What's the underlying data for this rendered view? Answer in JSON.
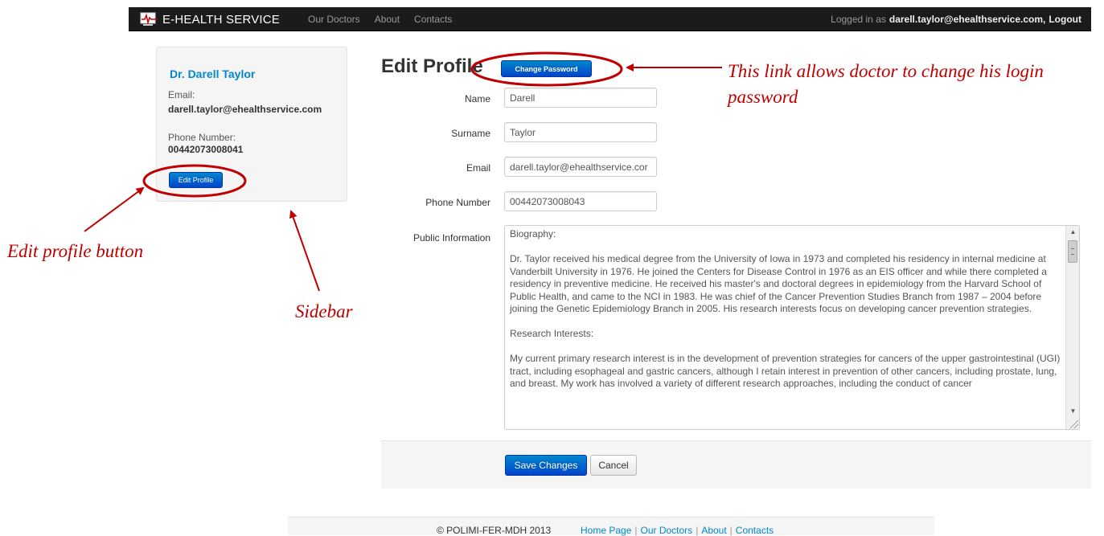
{
  "navbar": {
    "brand": "E-HEALTH SERVICE",
    "links": [
      "Our Doctors",
      "About",
      "Contacts"
    ],
    "logged_in_prefix": "Logged in as",
    "user_email": "darell.taylor@ehealthservice.com,",
    "logout": "Logout"
  },
  "sidebar": {
    "name": "Dr. Darell Taylor",
    "email_label": "Email:",
    "email": "darell.taylor@ehealthservice.com",
    "phone_label": "Phone Number:",
    "phone": "00442073008041",
    "edit_button": "Edit Profile"
  },
  "form": {
    "title": "Edit Profile",
    "change_password": "Change Password",
    "fields": {
      "name": {
        "label": "Name",
        "value": "Darell"
      },
      "surname": {
        "label": "Surname",
        "value": "Taylor"
      },
      "email": {
        "label": "Email",
        "value": "darell.taylor@ehealthservice.cor"
      },
      "phone": {
        "label": "Phone Number",
        "value": "00442073008043"
      },
      "public_info": {
        "label": "Public Information",
        "value": "Biography:\n\nDr. Taylor received his medical degree from the University of Iowa in 1973 and completed his residency in internal medicine at Vanderbilt University in 1976. He joined the Centers for Disease Control in 1976 as an EIS officer and while there completed a residency in preventive medicine. He received his master's and doctoral degrees in epidemiology from the Harvard School of Public Health, and came to the NCI in 1983. He was chief of the Cancer Prevention Studies Branch from 1987 – 2004 before joining the Genetic Epidemiology Branch in 2005. His research interests focus on developing cancer prevention strategies.\n\nResearch Interests:\n\nMy current primary research interest is in the development of prevention strategies for cancers of the upper gastrointestinal (UGI) tract, including esophageal and gastric cancers, although I retain interest in prevention of other cancers, including prostate, lung, and breast. My work has involved a variety of different research approaches, including the conduct of cancer"
      }
    },
    "save": "Save Changes",
    "cancel": "Cancel"
  },
  "footer": {
    "copyright": "© POLIMI-FER-MDH 2013",
    "links": [
      "Home Page",
      "Our Doctors",
      "About",
      "Contacts"
    ]
  },
  "annotations": {
    "change_password_note_line1": "This link allows doctor to change his login",
    "change_password_note_line2": "password",
    "edit_profile_note": "Edit profile button",
    "sidebar_note": "Sidebar",
    "color": "#c00000"
  }
}
